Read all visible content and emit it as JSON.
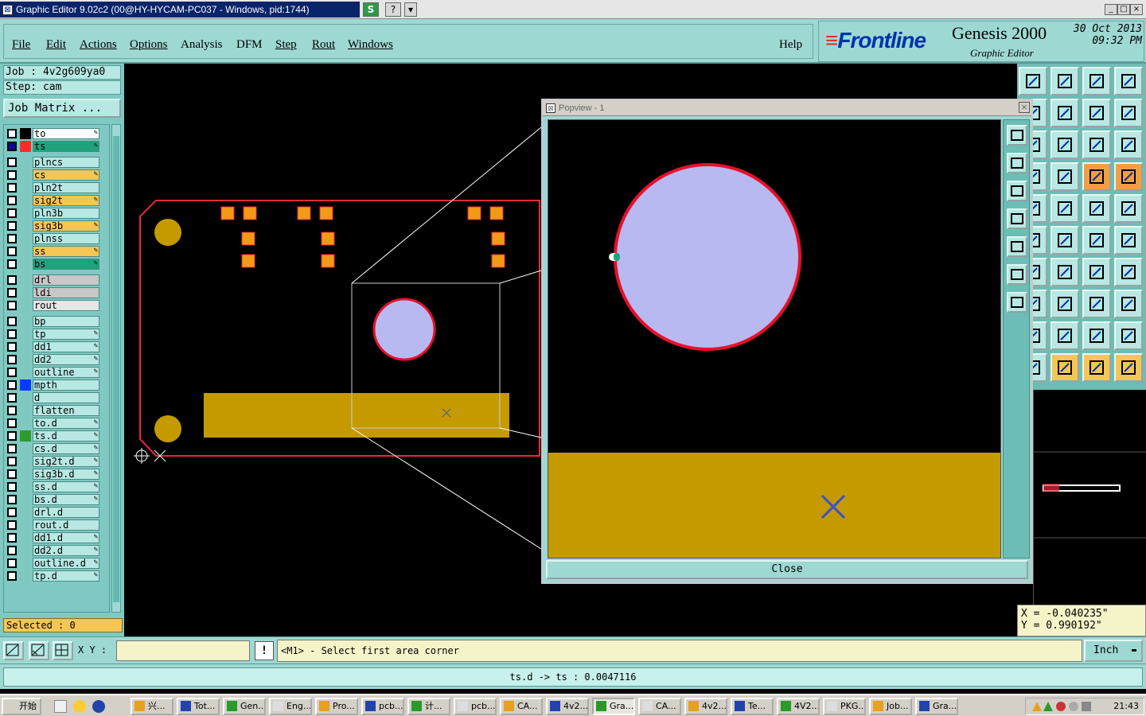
{
  "window": {
    "title": "Graphic Editor 9.02c2 (00@HY-HYCAM-PC037 - Windows, pid:1744)",
    "buttons": {
      "s": "S",
      "help": "?",
      "dropdown": "▾",
      "minimize": "_",
      "maximize": "□",
      "close": "×"
    }
  },
  "menu": {
    "items": [
      "File",
      "Edit",
      "Actions",
      "Options",
      "Analysis",
      "DFM",
      "Step",
      "Rout",
      "Windows"
    ],
    "help": "Help"
  },
  "brand": {
    "logo": "Frontline",
    "product": "Genesis 2000",
    "subtitle": "Graphic Editor",
    "date_line1": "30 Oct 2013",
    "date_line2": "09:32 PM"
  },
  "job": {
    "job_label": "Job : 4v2g609ya0",
    "step_label": "Step: cam",
    "matrix_button": "Job Matrix ..."
  },
  "layers": [
    {
      "name": "to",
      "color": "#ffffff",
      "swatch": "#000000",
      "editable": true
    },
    {
      "name": "ts",
      "color": "#1fa37a",
      "swatch": "#ff2a2a",
      "editable": true,
      "active": true
    },
    {
      "name": "plncs",
      "color": "#b7e8e3",
      "swatch": "",
      "editable": false
    },
    {
      "name": "cs",
      "color": "#f5c654",
      "swatch": "",
      "editable": true
    },
    {
      "name": "pln2t",
      "color": "#b7e8e3",
      "swatch": "",
      "editable": false
    },
    {
      "name": "sig2t",
      "color": "#f5c654",
      "swatch": "",
      "editable": true
    },
    {
      "name": "pln3b",
      "color": "#b7e8e3",
      "swatch": "",
      "editable": false
    },
    {
      "name": "sig3b",
      "color": "#f5c654",
      "swatch": "",
      "editable": true
    },
    {
      "name": "plnss",
      "color": "#b7e8e3",
      "swatch": "",
      "editable": false
    },
    {
      "name": "ss",
      "color": "#f5c654",
      "swatch": "",
      "editable": true
    },
    {
      "name": "bs",
      "color": "#1fa37a",
      "swatch": "",
      "editable": true
    },
    {
      "name": "drl",
      "color": "#c8c8c8",
      "swatch": "",
      "editable": false
    },
    {
      "name": "ldi",
      "color": "#c8c8c8",
      "swatch": "",
      "editable": false
    },
    {
      "name": "rout",
      "color": "#e6e6e6",
      "swatch": "",
      "editable": false
    },
    {
      "name": "bp",
      "color": "#b7e8e3",
      "swatch": "",
      "editable": false
    },
    {
      "name": "tp",
      "color": "#b7e8e3",
      "swatch": "",
      "editable": true
    },
    {
      "name": "dd1",
      "color": "#b7e8e3",
      "swatch": "",
      "editable": true
    },
    {
      "name": "dd2",
      "color": "#b7e8e3",
      "swatch": "",
      "editable": true
    },
    {
      "name": "outline",
      "color": "#b7e8e3",
      "swatch": "",
      "editable": true
    },
    {
      "name": "mpth",
      "color": "#b7e8e3",
      "swatch": "#0a3cff",
      "editable": false
    },
    {
      "name": "d",
      "color": "#b7e8e3",
      "swatch": "",
      "editable": false
    },
    {
      "name": "flatten",
      "color": "#b7e8e3",
      "swatch": "",
      "editable": false
    },
    {
      "name": "to.d",
      "color": "#b7e8e3",
      "swatch": "",
      "editable": true
    },
    {
      "name": "ts.d",
      "color": "#b7e8e3",
      "swatch": "#2f9a2f",
      "editable": true
    },
    {
      "name": "cs.d",
      "color": "#b7e8e3",
      "swatch": "",
      "editable": true
    },
    {
      "name": "sig2t.d",
      "color": "#b7e8e3",
      "swatch": "",
      "editable": true
    },
    {
      "name": "sig3b.d",
      "color": "#b7e8e3",
      "swatch": "",
      "editable": true
    },
    {
      "name": "ss.d",
      "color": "#b7e8e3",
      "swatch": "",
      "editable": true
    },
    {
      "name": "bs.d",
      "color": "#b7e8e3",
      "swatch": "",
      "editable": true
    },
    {
      "name": "drl.d",
      "color": "#b7e8e3",
      "swatch": "",
      "editable": false
    },
    {
      "name": "rout.d",
      "color": "#b7e8e3",
      "swatch": "",
      "editable": false
    },
    {
      "name": "dd1.d",
      "color": "#b7e8e3",
      "swatch": "",
      "editable": true
    },
    {
      "name": "dd2.d",
      "color": "#b7e8e3",
      "swatch": "",
      "editable": true
    },
    {
      "name": "outline.d",
      "color": "#b7e8e3",
      "swatch": "",
      "editable": true
    },
    {
      "name": "tp.d",
      "color": "#b7e8e3",
      "swatch": "",
      "editable": true
    }
  ],
  "selected_label": "Selected : 0",
  "popview": {
    "title": "Popview - 1",
    "close_button": "Close"
  },
  "coords": {
    "x": "X = -0.040235\"",
    "y": "Y = 0.990192\""
  },
  "command": {
    "xy_label": "X Y :",
    "xy_value": "",
    "bang": "!",
    "prompt": "<M1> - Select first area corner",
    "units": "Inch"
  },
  "status": "ts.d -> ts : 0.0047116",
  "colors": {
    "board_outline": "#e8283a",
    "copper": "#c49a00",
    "pad_fill": "#f29a18",
    "pad_border": "#e8283a",
    "circle_fill": "#b9b9f2",
    "circle_ring": "#e8102a",
    "teal_panel": "#9ed8d3"
  },
  "taskbar": {
    "start": "开始",
    "tasks": [
      "兴...",
      "Tot...",
      "Gen...",
      "Eng...",
      "Pro...",
      "pcb...",
      "计...",
      "pcb...",
      "CA...",
      "4v2...",
      "Gra...",
      "CA...",
      "4v2...",
      "Te...",
      "4V2...",
      "PKG...",
      "Job...",
      "Gra..."
    ],
    "active_index": 10,
    "clock": "21:43"
  }
}
